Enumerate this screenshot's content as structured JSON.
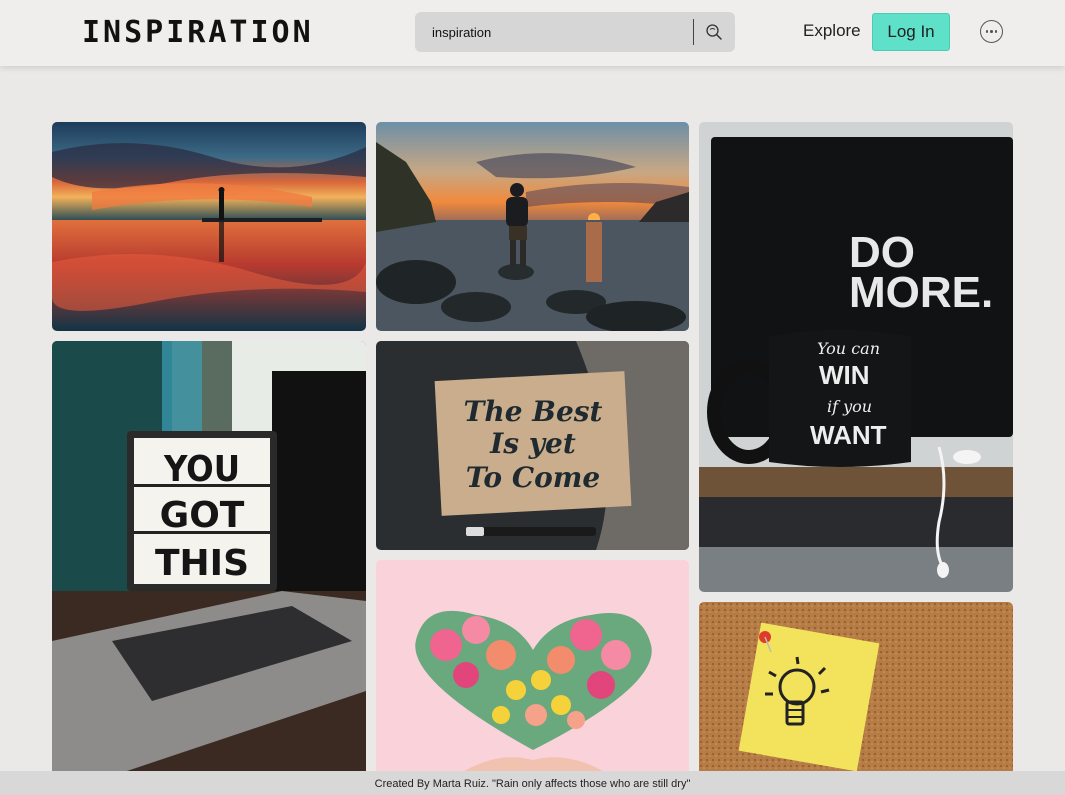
{
  "header": {
    "logo": "INSPIRATION",
    "search": {
      "value": "inspiration",
      "placeholder": "Search"
    },
    "nav_explore": "Explore",
    "login_label": "Log In"
  },
  "gallery": {
    "images": [
      {
        "id": "sunset-lake-silhouette"
      },
      {
        "id": "man-on-rocks-sunset"
      },
      {
        "id": "do-more-mug",
        "text_monitor": "DO MORE.",
        "text_mug": [
          "You can",
          "WIN",
          "if you",
          "WANT"
        ]
      },
      {
        "id": "you-got-this-lightbox",
        "text": [
          "YOU",
          "GOT",
          "THIS"
        ]
      },
      {
        "id": "best-is-yet-to-come",
        "text": [
          "The Best",
          "Is yet",
          "To Come"
        ]
      },
      {
        "id": "flower-heart"
      },
      {
        "id": "lightbulb-sticky-note"
      }
    ]
  },
  "footer": {
    "credit": "Created By Marta Ruiz. \"Rain only affects those who are still dry\""
  },
  "colors": {
    "accent": "#5ee0c9",
    "background": "#ebe9e8",
    "header_bg": "#efeeed",
    "search_bg": "#d6d6d6",
    "footer_bg": "#d8d8d8"
  },
  "icons": [
    "search-icon",
    "more-options-icon"
  ]
}
